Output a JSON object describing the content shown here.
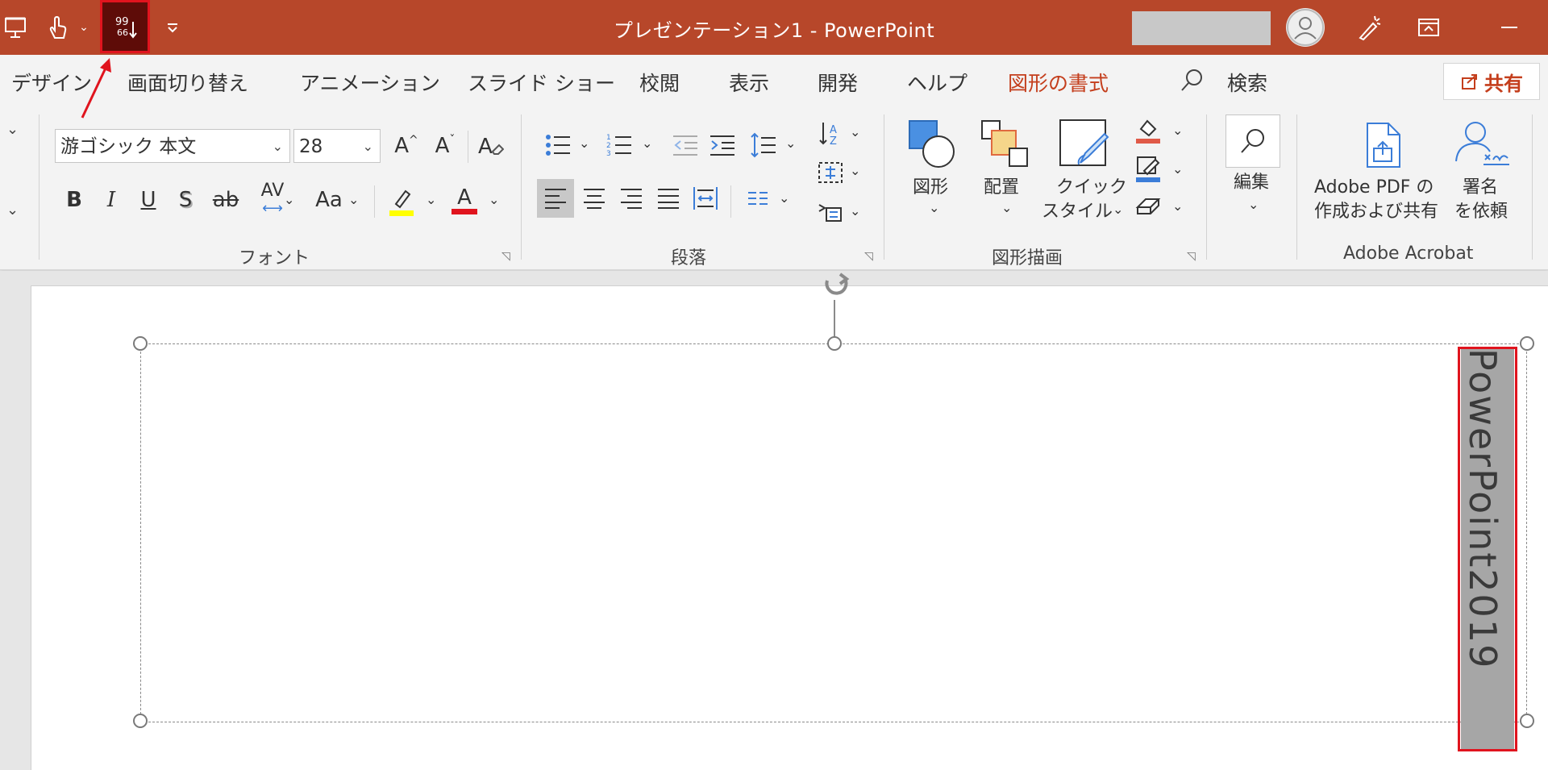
{
  "titlebar": {
    "title": "プレゼンテーション1  -  PowerPoint",
    "text_direction_icon_text": "99\n66",
    "colors": {
      "bar": "#b7472a",
      "highlight_border": "#e0141e"
    }
  },
  "tabs": [
    {
      "label": "デザイン"
    },
    {
      "label": "画面切り替え"
    },
    {
      "label": "アニメーション"
    },
    {
      "label": "スライド ショー"
    },
    {
      "label": "校閲"
    },
    {
      "label": "表示"
    },
    {
      "label": "開発"
    },
    {
      "label": "ヘルプ"
    },
    {
      "label": "図形の書式",
      "active": true
    },
    {
      "label": "検索"
    }
  ],
  "share_label": "共有",
  "font_group": {
    "font_name": "游ゴシック 本文",
    "font_size": "28",
    "grow_label": "A",
    "shrink_label": "A",
    "bold": "B",
    "italic": "I",
    "underline": "U",
    "shadow": "S",
    "strike": "ab",
    "spacing": "AV",
    "case": "Aa",
    "font_color_letter": "A",
    "label": "フォント"
  },
  "paragraph_group": {
    "label": "段落"
  },
  "drawing_group": {
    "shapes_label": "図形",
    "arrange_label": "配置",
    "quick_style_line1": "クイック",
    "quick_style_line2": "スタイル",
    "label": "図形描画"
  },
  "editing_group": {
    "label": "編集"
  },
  "acrobat_group": {
    "pdf_line1": "Adobe PDF の",
    "pdf_line2": "作成および共有",
    "sign_line1": "署名",
    "sign_line2": "を依頼",
    "label": "Adobe Acrobat"
  },
  "slide": {
    "vertical_text": "PowerPoint2019"
  }
}
